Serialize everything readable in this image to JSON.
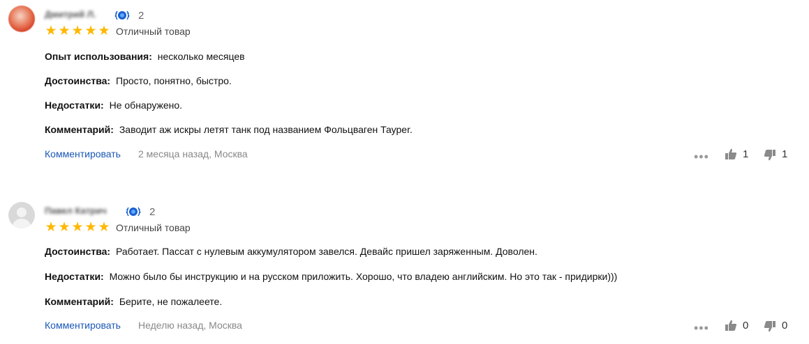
{
  "reviews": [
    {
      "author": "Дмитрий Л.",
      "badge_count": "2",
      "stars": 5,
      "rating_text": "Отличный товар",
      "fields": [
        {
          "label": "Опыт использования:",
          "value": "несколько месяцев"
        },
        {
          "label": "Достоинства:",
          "value": "Просто, понятно, быстро."
        },
        {
          "label": "Недостатки:",
          "value": "Не обнаружено."
        },
        {
          "label": "Комментарий:",
          "value": "Заводит аж искры летят танк под названием Фольцваген Тауреr."
        }
      ],
      "comment_link": "Комментировать",
      "meta": "2 месяца назад, Москва",
      "likes": "1",
      "dislikes": "1"
    },
    {
      "author": "Павел Катрич",
      "badge_count": "2",
      "stars": 5,
      "rating_text": "Отличный товар",
      "fields": [
        {
          "label": "Достоинства:",
          "value": "Работает. Пассат с нулевым аккумулятором завелся. Девайс пришел заряженным. Доволен."
        },
        {
          "label": "Недостатки:",
          "value": "Можно было бы инструкцию и на русском приложить. Хорошо, что владею английским. Но это так - придирки)))"
        },
        {
          "label": "Комментарий:",
          "value": "Берите, не пожалеете."
        }
      ],
      "comment_link": "Комментировать",
      "meta": "Неделю назад, Москва",
      "likes": "0",
      "dislikes": "0"
    }
  ],
  "colors": {
    "star": "#ffb800",
    "link": "#1a57b6",
    "badge": "#1a5fd0"
  },
  "icons": {
    "badge": "laurel-badge-icon",
    "more": "more-dots-icon",
    "like": "thumbs-up-icon",
    "dislike": "thumbs-down-icon"
  }
}
